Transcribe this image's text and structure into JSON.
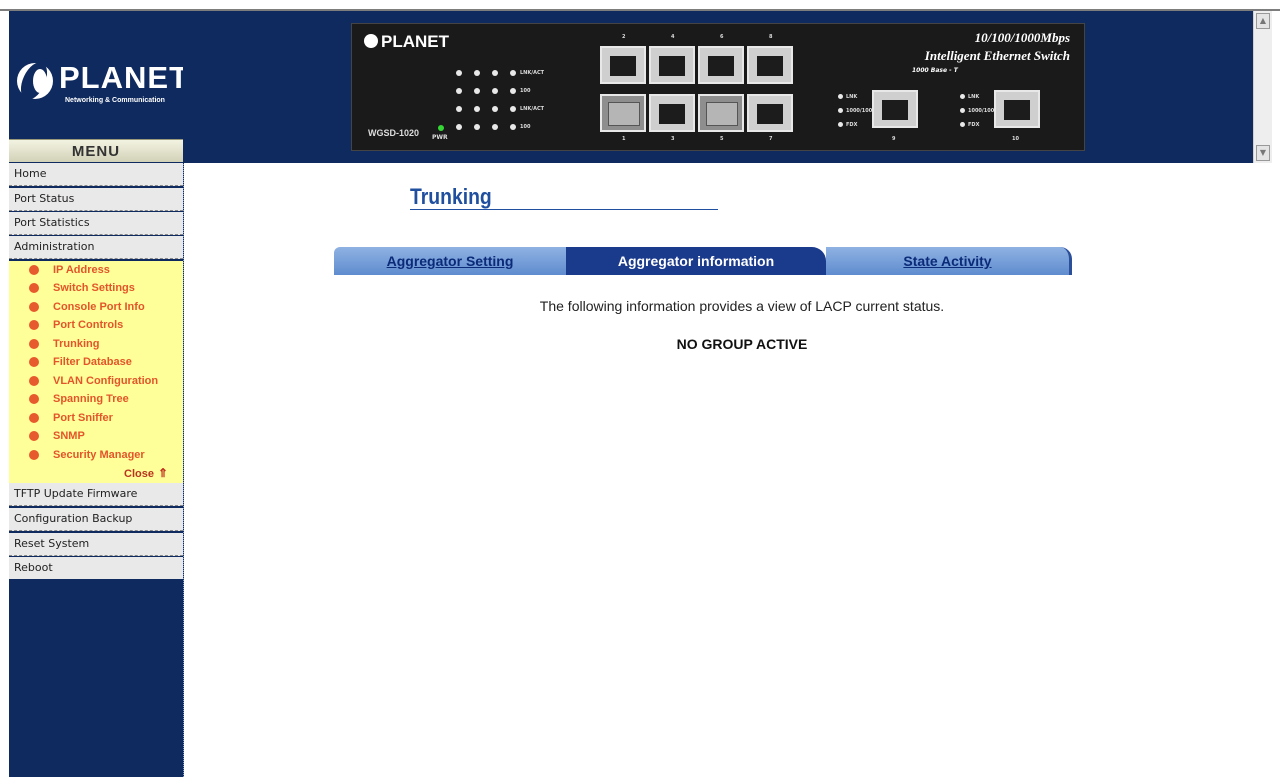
{
  "logo": {
    "name": "PLANET",
    "tagline": "Networking & Communication"
  },
  "panel": {
    "brand": "PLANET",
    "model": "WGSD-1020",
    "speed": "10/100/1000Mbps",
    "product": "Intelligent Ethernet Switch",
    "base": "1000 Base - T",
    "pwr_label": "PWR",
    "led_labels": [
      "LNK/ACT",
      "100",
      "LNK/ACT",
      "100"
    ],
    "port_top_numbers": [
      "2",
      "4",
      "6",
      "8"
    ],
    "port_bottom_numbers": [
      "1",
      "3",
      "5",
      "7"
    ],
    "gig_ports": [
      "9",
      "10"
    ],
    "gig_led_labels": [
      "LNK",
      "1000/100",
      "FDX"
    ]
  },
  "sidebar": {
    "menu_title": "MENU",
    "items": [
      {
        "label": "Home"
      },
      {
        "label": "Port Status"
      },
      {
        "label": "Port Statistics"
      },
      {
        "label": "Administration"
      }
    ],
    "admin_items": [
      {
        "label": "IP Address"
      },
      {
        "label": "Switch Settings"
      },
      {
        "label": "Console Port Info"
      },
      {
        "label": "Port Controls"
      },
      {
        "label": "Trunking"
      },
      {
        "label": "Filter Database"
      },
      {
        "label": "VLAN Configuration"
      },
      {
        "label": "Spanning Tree"
      },
      {
        "label": "Port Sniffer"
      },
      {
        "label": "SNMP"
      },
      {
        "label": "Security Manager"
      }
    ],
    "close_label": "Close",
    "bottom_items": [
      {
        "label": "TFTP Update Firmware"
      },
      {
        "label": "Configuration Backup"
      },
      {
        "label": "Reset System"
      },
      {
        "label": "Reboot"
      }
    ]
  },
  "main": {
    "title": "Trunking",
    "tabs": [
      {
        "label": "Aggregator Setting",
        "active": false
      },
      {
        "label": "Aggregator information",
        "active": true
      },
      {
        "label": "State Activity",
        "active": false
      }
    ],
    "info_text": "The following information provides a view of LACP current status.",
    "status_text": "NO GROUP ACTIVE"
  },
  "colors": {
    "navy": "#0f2a5e",
    "submenu_bg": "#ffff99",
    "submenu_text": "#e3552a",
    "title_blue": "#1f4f9e",
    "tab_active": "#1a3a8c",
    "tab_inactive": "#6f97d6"
  }
}
